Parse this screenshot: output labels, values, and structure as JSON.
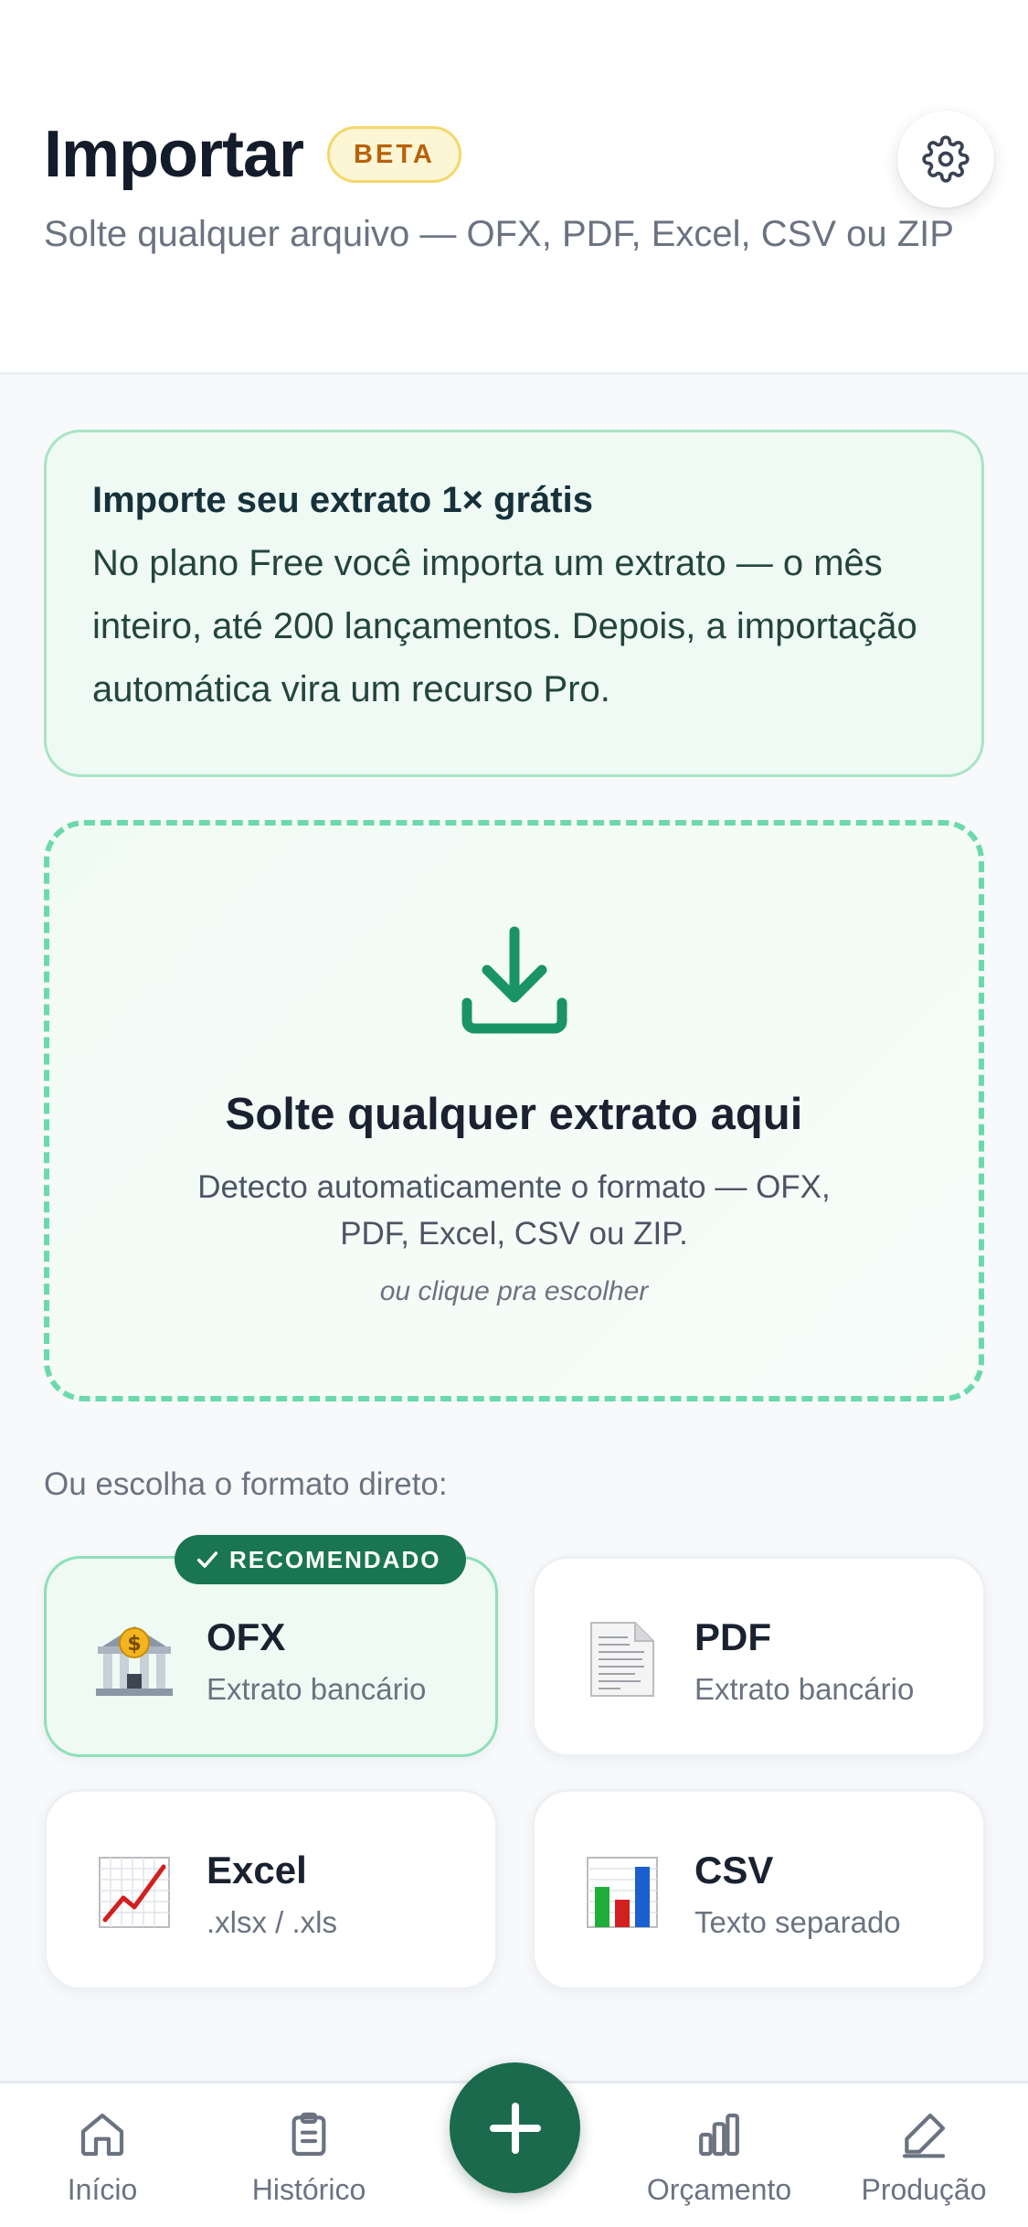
{
  "header": {
    "title": "Importar",
    "badge": "BETA",
    "subtitle": "Solte qualquer arquivo — OFX, PDF, Excel, CSV ou ZIP",
    "settings_icon": "gear-icon"
  },
  "info_card": {
    "title": "Importe seu extrato 1× grátis",
    "body": "No plano Free você importa um extrato — o mês inteiro, até 200 lançamentos. Depois, a importação automática vira um recurso Pro."
  },
  "dropzone": {
    "icon": "download-icon",
    "title": "Solte qualquer extrato aqui",
    "description": "Detecto automaticamente o formato — OFX, PDF, Excel, CSV ou ZIP.",
    "hint": "ou clique pra escolher"
  },
  "formats": {
    "label": "Ou escolha o formato direto:",
    "recommended_badge": "RECOMENDADO",
    "items": [
      {
        "name": "OFX",
        "description": "Extrato bancário",
        "icon": "bank-icon"
      },
      {
        "name": "PDF",
        "description": "Extrato bancário",
        "icon": "document-icon"
      },
      {
        "name": "Excel",
        "description": ".xlsx / .xls",
        "icon": "line-chart-icon"
      },
      {
        "name": "CSV",
        "description": "Texto separado",
        "icon": "bar-chart-icon"
      }
    ]
  },
  "nav": {
    "items": [
      {
        "label": "Início",
        "icon": "home-icon"
      },
      {
        "label": "Histórico",
        "icon": "clipboard-icon"
      },
      {
        "label": "Orçamento",
        "icon": "bar-chart-icon"
      },
      {
        "label": "Produção",
        "icon": "pen-icon"
      }
    ],
    "fab_icon": "plus-icon"
  },
  "colors": {
    "accent": "#1b6a4d",
    "accent_light": "#eefaf3",
    "dashed_border": "#6bd9ac",
    "beta_text": "#b8620a"
  }
}
